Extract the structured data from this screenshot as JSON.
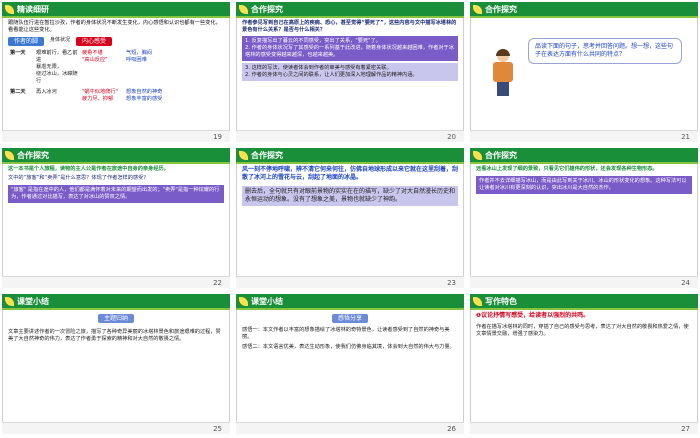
{
  "slides": [
    {
      "num": "19",
      "tag": "精读细研",
      "intro": "跟随队伍行进在暂拉沙孜，作者的身体状况不断发生变化，内心感悟和认识也都有一些变化，看看能让这些变化。",
      "headers": [
        "作者的脚",
        "身体状况",
        "内心感受"
      ],
      "rows": [
        {
          "label": "第一天",
          "c1": "艰难前行，看乙前进\n暴虐无限，\n绕过冰山，冰嶂随行",
          "c2": "疲惫不堪\n\"高山反应\"",
          "c3": "气短，胸闷\n呼吸困难"
        },
        {
          "label": "第二天",
          "c1": "再入冰河",
          "c2": "\"蜗牛似地爬行\"\n疲力尽、抑郁",
          "c3": "想象自然的神奇\n想象丰富的感受"
        }
      ]
    },
    {
      "num": "20",
      "tag": "合作探究",
      "q": "作者参见写到自己在高原上的疾病、恐心，甚至觉得“要死了”，这些内容与文中描写冰塔林的景色有什么关系？是否与什么相关？",
      "a1": "1. 反复描写出了暮云的不同感受，突出了关系，\"要死\"了。",
      "a2": "2. 作者的身体状况写了其感受的一系列基于此改进，随着身体状况越来越困难，作者对于冰塔林的感受变得越来越深，也越来越美。",
      "a3": "3. 这样的写法，使读者体会到作者的审美与感受有着紧密关联。",
      "a4": "2. 作者的身体与心灵之间的联系，让人们更加深入地理解作品的精神内涵。"
    },
    {
      "num": "21",
      "tag": "合作探究",
      "callout": "品读下面的句子，思考并回答问题。想一想，这些句子在表达方面有什么共同的特点？"
    },
    {
      "num": "22",
      "tag": "合作探究",
      "p1": "这一本书是个人旅程，读物的主人公是作者在旅途中自身的亲身经历。",
      "p2": "文中的“旅客”和“卖弄”是什么意思？体现了作者怎样的感受？",
      "box": "\"旅客\" 是指在途中的人，他们都是满怀着对未来的期望而出发的；\"卖弄\"是指一种炫耀的行为，作者通过对比描写，表达了对冰山的赞叹之情。"
    },
    {
      "num": "23",
      "tag": "合作探究",
      "p1": "风一刻不停地呼啸，辨不清它何来何往，仿佛自地球形成以来它就在这里刮着，刮散了冰河上的雪花与云，刮起了地面的冰晶。",
      "p2": "删去后，全句就只有对眼前景物的实实在在的描写，缺少了对大自然漫长历史和永恒运动的想象。没有了想象之美，景物也就缺少了神韵。"
    },
    {
      "num": "24",
      "tag": "合作探究",
      "p1": "远看冰山上发现了细的景致，只看见它们雄伟的形状，还会发现各种生物形态。",
      "p2": "作者并不去详细描写冰山，而是由此写到关于冰川、冰山的形状变化的想象。这种写法可以让读者对冰川有更深刻的认识，突出冰川是大自然的杰作。"
    },
    {
      "num": "25",
      "tag": "课堂小结",
      "badge": "主题归纳",
      "p": "文章主要讲述作者的一次冒险之旅，描写了各种奇异美丽的冰塔林景色和旅途艰难的过程，赞美了大自然神奇的伟力，表达了作者勇于探索的精神和对大自然的敬畏之情。"
    },
    {
      "num": "26",
      "tag": "课堂小结",
      "badge": "感悟分享",
      "p1": "感悟一：本文作者以丰富的想象描绘了冰塔林的奇特景色，让读者感受到了自然的神奇与美丽。",
      "p2": "感悟二：本文语言优美，表达生动形象，使我们仿佛身临其境，体会到大自然的伟大与力量。"
    },
    {
      "num": "27",
      "tag": "写作特色",
      "lead": "议论抒情写感受，给读者以强烈的共鸣。",
      "p": "作者在描写冰塔林的同时，穿插了自己的感受与思考，表达了对大自然的敬畏和热爱之情，使文章情景交融，增强了感染力。"
    }
  ]
}
